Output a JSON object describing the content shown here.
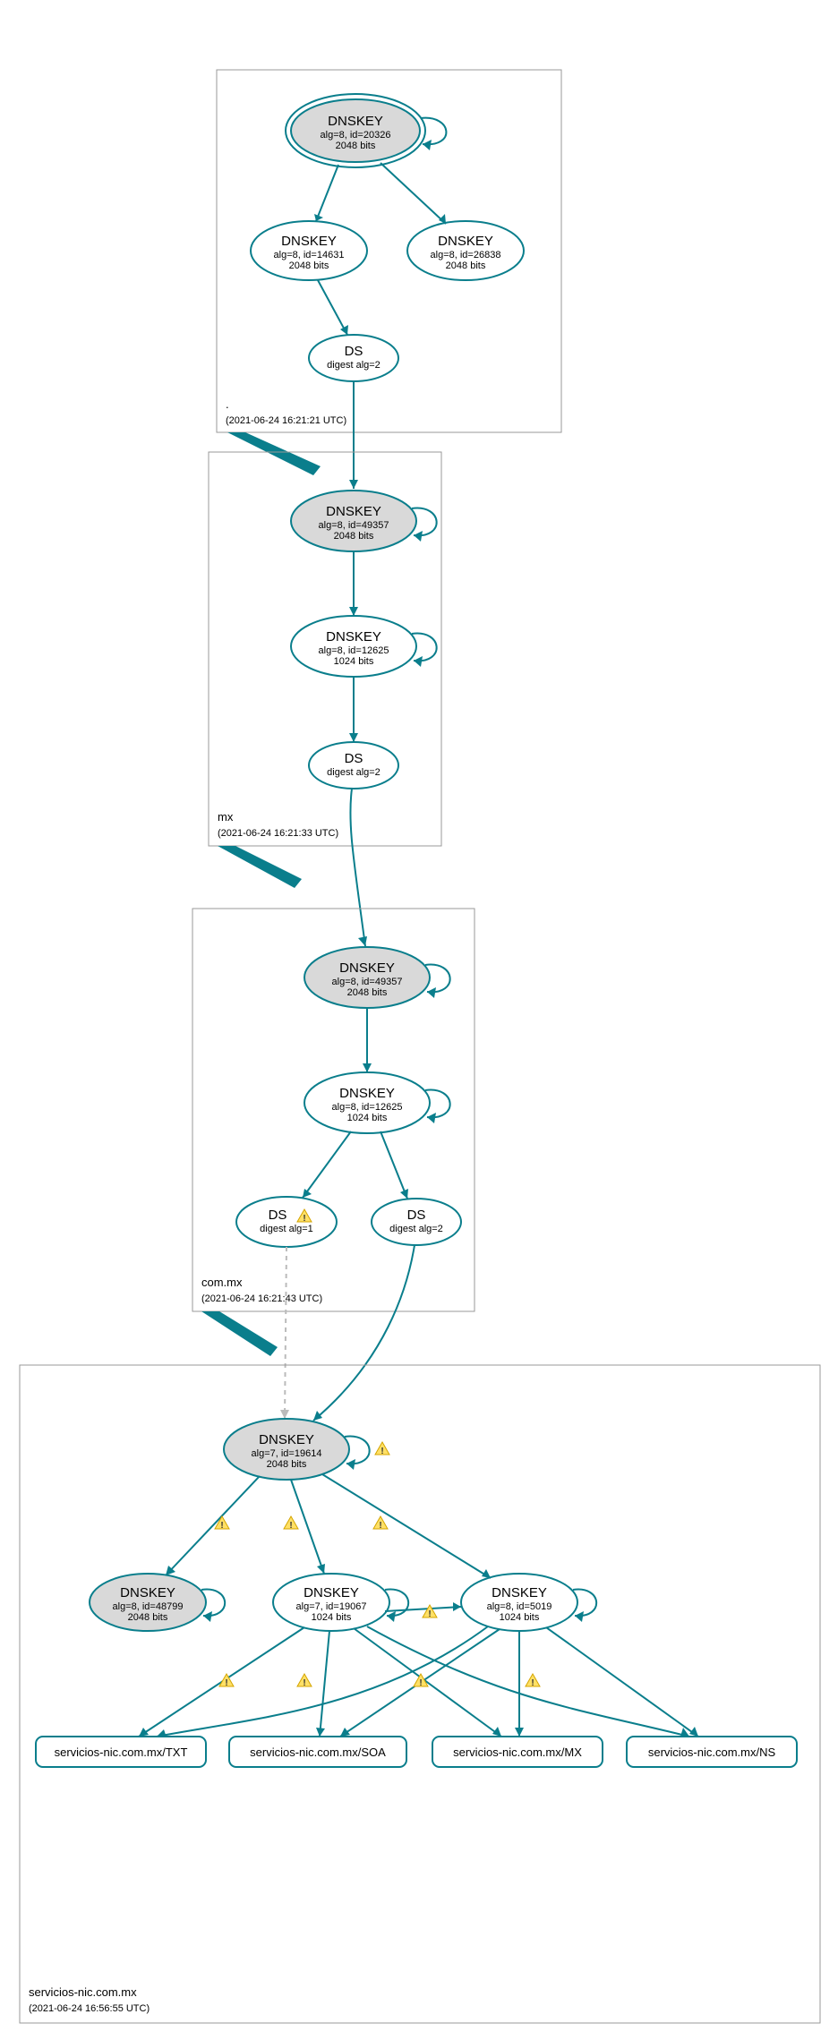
{
  "chart_data": {
    "type": "dnssec-auth-graph",
    "zones": [
      {
        "name": ".",
        "timestamp": "(2021-06-24 16:21:21 UTC)",
        "nodes": [
          {
            "id": "root_ksk",
            "type": "DNSKEY",
            "ksk": true,
            "double_ring": true,
            "alg": 8,
            "key_id": 20326,
            "bits": 2048,
            "self_signed": true
          },
          {
            "id": "root_zsk",
            "type": "DNSKEY",
            "alg": 8,
            "key_id": 14631,
            "bits": 2048
          },
          {
            "id": "root_zsk2",
            "type": "DNSKEY",
            "alg": 8,
            "key_id": 26838,
            "bits": 2048
          },
          {
            "id": "root_ds",
            "type": "DS",
            "digest_alg": 2
          }
        ],
        "edges": [
          [
            "root_ksk",
            "root_zsk"
          ],
          [
            "root_ksk",
            "root_zsk2"
          ],
          [
            "root_zsk",
            "root_ds"
          ]
        ]
      },
      {
        "name": "mx",
        "timestamp": "(2021-06-24 16:21:33 UTC)",
        "nodes": [
          {
            "id": "mx_ksk",
            "type": "DNSKEY",
            "ksk": true,
            "alg": 8,
            "key_id": 49357,
            "bits": 2048,
            "self_signed": true
          },
          {
            "id": "mx_zsk",
            "type": "DNSKEY",
            "alg": 8,
            "key_id": 12625,
            "bits": 1024,
            "self_signed": true
          },
          {
            "id": "mx_ds",
            "type": "DS",
            "digest_alg": 2
          }
        ],
        "edges": [
          [
            "mx_ksk",
            "mx_zsk"
          ],
          [
            "mx_zsk",
            "mx_ds"
          ]
        ]
      },
      {
        "name": "com.mx",
        "timestamp": "(2021-06-24 16:21:43 UTC)",
        "nodes": [
          {
            "id": "cmx_ksk",
            "type": "DNSKEY",
            "ksk": true,
            "alg": 8,
            "key_id": 49357,
            "bits": 2048,
            "self_signed": true
          },
          {
            "id": "cmx_zsk",
            "type": "DNSKEY",
            "alg": 8,
            "key_id": 12625,
            "bits": 1024,
            "self_signed": true
          },
          {
            "id": "cmx_ds1",
            "type": "DS",
            "digest_alg": 1,
            "warning": true
          },
          {
            "id": "cmx_ds2",
            "type": "DS",
            "digest_alg": 2
          }
        ],
        "edges": [
          [
            "cmx_ksk",
            "cmx_zsk"
          ],
          [
            "cmx_zsk",
            "cmx_ds1"
          ],
          [
            "cmx_zsk",
            "cmx_ds2"
          ]
        ]
      },
      {
        "name": "servicios-nic.com.mx",
        "timestamp": "(2021-06-24 16:56:55 UTC)",
        "nodes": [
          {
            "id": "s_ksk",
            "type": "DNSKEY",
            "ksk": true,
            "alg": 7,
            "key_id": 19614,
            "bits": 2048,
            "self_signed": true,
            "self_signed_warning": true
          },
          {
            "id": "s_key2",
            "type": "DNSKEY",
            "ksk": true,
            "alg": 8,
            "key_id": 48799,
            "bits": 2048,
            "self_signed": true
          },
          {
            "id": "s_zsk",
            "type": "DNSKEY",
            "alg": 7,
            "key_id": 19067,
            "bits": 1024,
            "self_signed": true
          },
          {
            "id": "s_key4",
            "type": "DNSKEY",
            "alg": 8,
            "key_id": 5019,
            "bits": 1024,
            "self_signed": true
          },
          {
            "id": "s_txt",
            "type": "RRset",
            "label": "servicios-nic.com.mx/TXT"
          },
          {
            "id": "s_soa",
            "type": "RRset",
            "label": "servicios-nic.com.mx/SOA"
          },
          {
            "id": "s_mx",
            "type": "RRset",
            "label": "servicios-nic.com.mx/MX"
          },
          {
            "id": "s_ns",
            "type": "RRset",
            "label": "servicios-nic.com.mx/NS"
          }
        ],
        "edges": [
          [
            "s_ksk",
            "s_key2",
            "warn"
          ],
          [
            "s_ksk",
            "s_zsk",
            "warn"
          ],
          [
            "s_ksk",
            "s_key4",
            "warn"
          ],
          [
            "s_zsk",
            "s_txt",
            "warn"
          ],
          [
            "s_zsk",
            "s_soa",
            "warn"
          ],
          [
            "s_zsk",
            "s_mx"
          ],
          [
            "s_zsk",
            "s_ns"
          ],
          [
            "s_key4",
            "s_txt"
          ],
          [
            "s_key4",
            "s_soa"
          ],
          [
            "s_key4",
            "s_mx",
            "warn"
          ],
          [
            "s_key4",
            "s_ns",
            "warn"
          ],
          [
            "s_zsk",
            "s_key4",
            "warn"
          ]
        ]
      }
    ],
    "delegations": [
      {
        "from": "root_ds",
        "to": "mx_ksk"
      },
      {
        "from": "mx_ds",
        "to": "cmx_ksk"
      },
      {
        "from": "cmx_ds1",
        "to": "s_ksk",
        "style": "dashed"
      },
      {
        "from": "cmx_ds2",
        "to": "s_ksk"
      }
    ]
  },
  "labels": {
    "DNSKEY": "DNSKEY",
    "DS": "DS",
    "alg_prefix": "alg=",
    "id_prefix": ", id=",
    "bits_suffix": " bits",
    "digest_prefix": "digest alg="
  },
  "zones": {
    "root": {
      "name": ".",
      "ts": "(2021-06-24 16:21:21 UTC)"
    },
    "mx": {
      "name": "mx",
      "ts": "(2021-06-24 16:21:33 UTC)"
    },
    "commx": {
      "name": "com.mx",
      "ts": "(2021-06-24 16:21:43 UTC)"
    },
    "snic": {
      "name": "servicios-nic.com.mx",
      "ts": "(2021-06-24 16:56:55 UTC)"
    }
  },
  "nodes": {
    "root_ksk": {
      "title": "DNSKEY",
      "l2": "alg=8, id=20326",
      "l3": "2048 bits"
    },
    "root_zsk": {
      "title": "DNSKEY",
      "l2": "alg=8, id=14631",
      "l3": "2048 bits"
    },
    "root_zsk2": {
      "title": "DNSKEY",
      "l2": "alg=8, id=26838",
      "l3": "2048 bits"
    },
    "root_ds": {
      "title": "DS",
      "l2": "digest alg=2"
    },
    "mx_ksk": {
      "title": "DNSKEY",
      "l2": "alg=8, id=49357",
      "l3": "2048 bits"
    },
    "mx_zsk": {
      "title": "DNSKEY",
      "l2": "alg=8, id=12625",
      "l3": "1024 bits"
    },
    "mx_ds": {
      "title": "DS",
      "l2": "digest alg=2"
    },
    "cmx_ksk": {
      "title": "DNSKEY",
      "l2": "alg=8, id=49357",
      "l3": "2048 bits"
    },
    "cmx_zsk": {
      "title": "DNSKEY",
      "l2": "alg=8, id=12625",
      "l3": "1024 bits"
    },
    "cmx_ds1": {
      "title": "DS",
      "l2": "digest alg=1"
    },
    "cmx_ds2": {
      "title": "DS",
      "l2": "digest alg=2"
    },
    "s_ksk": {
      "title": "DNSKEY",
      "l2": "alg=7, id=19614",
      "l3": "2048 bits"
    },
    "s_key2": {
      "title": "DNSKEY",
      "l2": "alg=8, id=48799",
      "l3": "2048 bits"
    },
    "s_zsk": {
      "title": "DNSKEY",
      "l2": "alg=7, id=19067",
      "l3": "1024 bits"
    },
    "s_key4": {
      "title": "DNSKEY",
      "l2": "alg=8, id=5019",
      "l3": "1024 bits"
    },
    "s_txt": {
      "label": "servicios-nic.com.mx/TXT"
    },
    "s_soa": {
      "label": "servicios-nic.com.mx/SOA"
    },
    "s_mx": {
      "label": "servicios-nic.com.mx/MX"
    },
    "s_ns": {
      "label": "servicios-nic.com.mx/NS"
    }
  }
}
